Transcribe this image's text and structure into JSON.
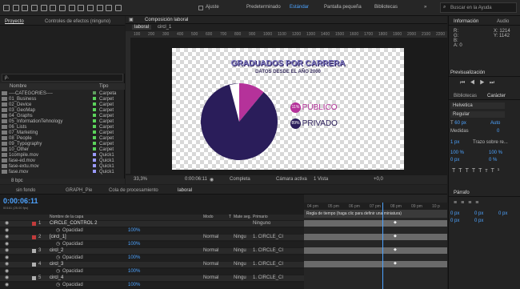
{
  "topbar": {
    "composition_tab": "Composición laboral",
    "adjust_label": "Ajuste",
    "workspaces": [
      "Predeterminado",
      "Estándar",
      "Pantalla pequeña",
      "Bibliotecas"
    ],
    "search_placeholder": "Buscar en la Ayuda"
  },
  "project_panel": {
    "tabs": [
      "Proyecto",
      "Controles de efectos (ninguno)"
    ],
    "search_value": "ρ.",
    "columns": [
      "Nombre",
      "Tipo"
    ],
    "items": [
      {
        "name": "----CATEGORIES----",
        "type": "Carpeta",
        "color": "#5f9e5f"
      },
      {
        "name": "01_Business",
        "type": "Carpet",
        "color": "#5bd35b"
      },
      {
        "name": "02_Device",
        "type": "Carpet",
        "color": "#5bd35b"
      },
      {
        "name": "03_GeoMap",
        "type": "Carpet",
        "color": "#5bd35b"
      },
      {
        "name": "04_Graphs",
        "type": "Carpet",
        "color": "#5bd35b"
      },
      {
        "name": "05_InformationTehnology",
        "type": "Carpet",
        "color": "#5bd35b"
      },
      {
        "name": "06_Lists",
        "type": "Carpet",
        "color": "#5bd35b"
      },
      {
        "name": "07_Marketing",
        "type": "Carpet",
        "color": "#5bd35b"
      },
      {
        "name": "08_People",
        "type": "Carpet",
        "color": "#5bd35b"
      },
      {
        "name": "09_Typography",
        "type": "Carpet",
        "color": "#5bd35b"
      },
      {
        "name": "10_Other",
        "type": "Carpet",
        "color": "#5bd35b"
      },
      {
        "name": "1compile.mov",
        "type": "Quick1",
        "color": "#9b9bff"
      },
      {
        "name": "fase-ed.mov",
        "type": "Quick1",
        "color": "#9b9bff"
      },
      {
        "name": "fase-extu.mov",
        "type": "Quick1",
        "color": "#9b9bff"
      },
      {
        "name": "fase.mov",
        "type": "Quick1",
        "color": "#9b9bff"
      }
    ],
    "bit_depth": "8 bpc"
  },
  "composition": {
    "tabs": [
      "laboral",
      "circl_1"
    ],
    "ruler": [
      "100",
      "200",
      "300",
      "400",
      "500",
      "600",
      "700",
      "800",
      "900",
      "1000",
      "1100",
      "1200",
      "1300",
      "1400",
      "1500",
      "1600",
      "1700",
      "1800",
      "1900",
      "2000",
      "2100",
      "2200"
    ],
    "title": "GRADUADOS POR CARRERA",
    "subtitle": "DATOS DESDE EL AÑO 2000",
    "legend": [
      {
        "pct": "11%",
        "label": "PÚBLICO",
        "color": "#b5329a"
      },
      {
        "pct": "89%",
        "label": "PRIVADO",
        "color": "#2a1d5a"
      }
    ],
    "footer": {
      "zoom": "33,3%",
      "timecode": "0:00:06:11",
      "quality": "Completa",
      "camera": "Cámara activa",
      "views": "1 Vista",
      "exposure": "+0,0"
    }
  },
  "chart_data": {
    "type": "pie",
    "title": "GRADUADOS POR CARRERA",
    "subtitle": "DATOS DESDE EL AÑO 2000",
    "categories": [
      "PÚBLICO",
      "PRIVADO"
    ],
    "values": [
      11,
      89
    ],
    "colors": [
      "#b5329a",
      "#2a1d5a"
    ]
  },
  "info_panel": {
    "tabs": [
      "Información",
      "Audio"
    ],
    "channels": [
      "R:",
      "G:",
      "B:",
      "A: 0"
    ],
    "coords": [
      "X: 1214",
      "Y: 1142"
    ]
  },
  "preview_panel": {
    "title": "Previsualización"
  },
  "character_panel": {
    "tabs": [
      "Bibliotecas",
      "Carácter"
    ],
    "font": "Helvetica",
    "style": "Regular",
    "size": "60 px",
    "leading": "Auto",
    "kerning": "Medidas",
    "tracking": "0",
    "stroke_width": "1 px",
    "stroke_mode": "Trazo sobre re...",
    "vscale": "100 %",
    "hscale": "100 %",
    "baseline": "0 px",
    "tsume": "0 %",
    "styles": [
      "T",
      "T",
      "TT",
      "Tт",
      "T¹",
      "T,"
    ]
  },
  "paragraph_panel": {
    "title": "Párrafo",
    "indent_left": "0 px",
    "indent_right": "0 px",
    "space_before": "0 px",
    "space_after": "0 px",
    "first_indent": "0 px"
  },
  "timeline": {
    "tabs": [
      "sin fondo",
      "GRAPH_Pie",
      "Cola de procesamiento",
      "laboral"
    ],
    "timecode": "0:00:06:11",
    "frames": "00161 (25.00 fps)",
    "columns": [
      "Nombre de la capa",
      "Modo",
      "T",
      "Mate seg.",
      "Primario"
    ],
    "ruler": [
      "04 pm",
      "05 pm",
      "06 pm",
      "07 pm",
      "08 pm",
      "09 pm",
      "10 p"
    ],
    "hint": "Regla de tiempo (haga clic para definir una miniatura)",
    "layers": [
      {
        "num": "1",
        "name": "CIRCLE_CONTROL 2",
        "mode": "",
        "trk": "",
        "parent": "Ninguno",
        "prop": null,
        "color": "#c23b3b"
      },
      {
        "num": "",
        "name": "Opacidad",
        "mode": "",
        "trk": "",
        "parent": "",
        "prop": "100%",
        "color": ""
      },
      {
        "num": "2",
        "name": "[circl_1]",
        "mode": "Normal",
        "trk": "Ningu",
        "parent": "1. CIRCLE_CI",
        "prop": null,
        "color": "#c23b3b"
      },
      {
        "num": "",
        "name": "Opacidad",
        "mode": "",
        "trk": "",
        "parent": "",
        "prop": "100%",
        "color": ""
      },
      {
        "num": "3",
        "name": "circl_2",
        "mode": "Normal",
        "trk": "Ningu",
        "parent": "1. CIRCLE_CI",
        "prop": null,
        "color": "#b0b0b0"
      },
      {
        "num": "",
        "name": "Opacidad",
        "mode": "",
        "trk": "",
        "parent": "",
        "prop": "100%",
        "color": ""
      },
      {
        "num": "4",
        "name": "circl_3",
        "mode": "Normal",
        "trk": "Ningu",
        "parent": "1. CIRCLE_CI",
        "prop": null,
        "color": "#b0b0b0"
      },
      {
        "num": "",
        "name": "Opacidad",
        "mode": "",
        "trk": "",
        "parent": "",
        "prop": "100%",
        "color": ""
      },
      {
        "num": "5",
        "name": "circl_4",
        "mode": "Normal",
        "trk": "Ningu",
        "parent": "1. CIRCLE_CI",
        "prop": null,
        "color": "#b0b0b0"
      },
      {
        "num": "",
        "name": "Opacidad",
        "mode": "",
        "trk": "",
        "parent": "",
        "prop": "100%",
        "color": ""
      }
    ]
  }
}
